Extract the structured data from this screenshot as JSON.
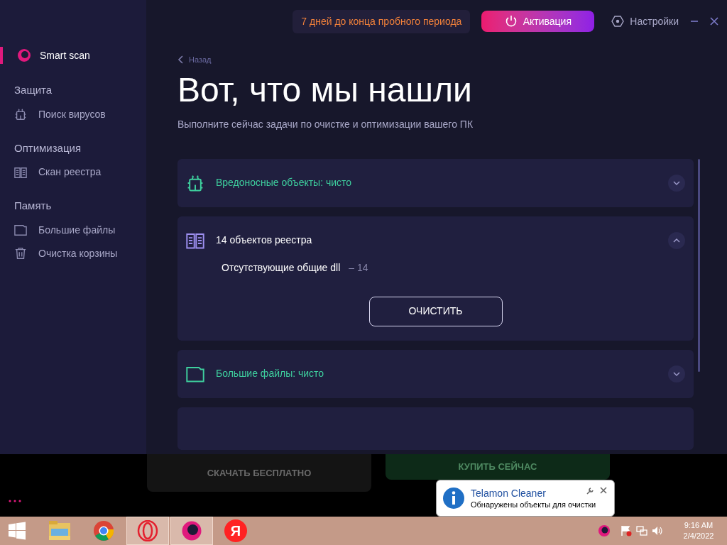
{
  "trial_banner": "7 дней до конца пробного периода",
  "activate_button": "Активация",
  "settings_button": "Настройки",
  "sidebar": {
    "top_item": {
      "label": "Smart scan",
      "selected": true
    },
    "sections": [
      {
        "title": "Защита",
        "items": [
          {
            "label": "Поиск вирусов",
            "selected": false
          }
        ]
      },
      {
        "title": "Оптимизация",
        "items": [
          {
            "label": "Скан реестра",
            "selected": false
          }
        ]
      },
      {
        "title": "Память",
        "items": [
          {
            "label": "Большие файлы",
            "selected": false
          },
          {
            "label": "Очистка корзины",
            "selected": false
          }
        ]
      }
    ]
  },
  "back_link": "Назад",
  "heading": "Вот, что мы нашли",
  "subtitle": "Выполните сейчас задачи по очистке и оптимизации вашего ПК",
  "results": [
    {
      "kind": "malware",
      "title": "Вредоносные объекты: чисто",
      "clean": true,
      "expanded": false
    },
    {
      "kind": "registry",
      "title": "14 объектов реестра",
      "clean": false,
      "expanded": true,
      "details": [
        {
          "label": "Отсутствующие общие dll",
          "count": "– 14"
        }
      ],
      "action": "ОЧИСТИТЬ"
    },
    {
      "kind": "files",
      "title": "Большие файлы: чисто",
      "clean": true,
      "expanded": false
    }
  ],
  "dimmed_buttons": [
    {
      "kind": "download",
      "label": "СКАЧАТЬ БЕСПЛАТНО"
    },
    {
      "kind": "buy",
      "label": "КУПИТЬ СЕЙЧАС"
    }
  ],
  "notification": {
    "title": "Telamon Cleaner",
    "message": "Обнаружены объекты для очистки"
  },
  "taskbar": {
    "apps": [
      {
        "kind": "explorer",
        "active": false
      },
      {
        "kind": "chrome",
        "active": false
      },
      {
        "kind": "opera",
        "active": true
      },
      {
        "kind": "telamon",
        "active": true
      },
      {
        "kind": "yandex",
        "letter": "Я",
        "active": false
      }
    ],
    "time": "9:16 AM",
    "date": "2/4/2022"
  }
}
